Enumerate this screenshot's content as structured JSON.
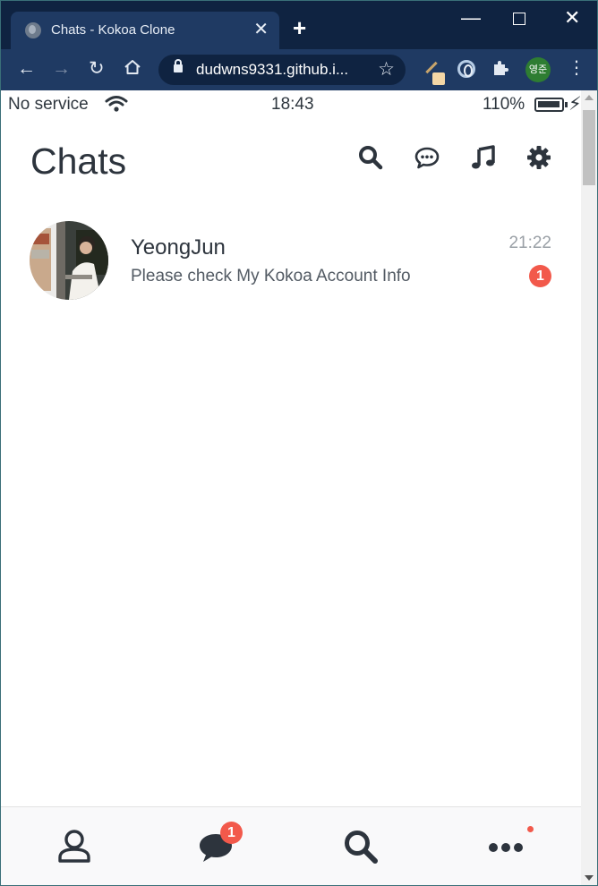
{
  "browser": {
    "tab_title": "Chats - Kokoa Clone",
    "tab_close": "✕",
    "new_tab": "+",
    "url": "dudwns9331.github.i...",
    "profile_initials": "영준",
    "window_controls": {
      "minimize": "—",
      "close": "✕"
    }
  },
  "status_bar": {
    "carrier": "No service",
    "time": "18:43",
    "battery": "110%"
  },
  "header": {
    "title": "Chats"
  },
  "chats": [
    {
      "name": "YeongJun",
      "preview": "Please check My Kokoa Account Info",
      "time": "21:22",
      "unread": "1"
    }
  ],
  "nav": {
    "chats_badge": "1"
  },
  "colors": {
    "badge": "#f2594b",
    "text_dark": "#2d343d",
    "browser_frame": "#1f3a63"
  }
}
